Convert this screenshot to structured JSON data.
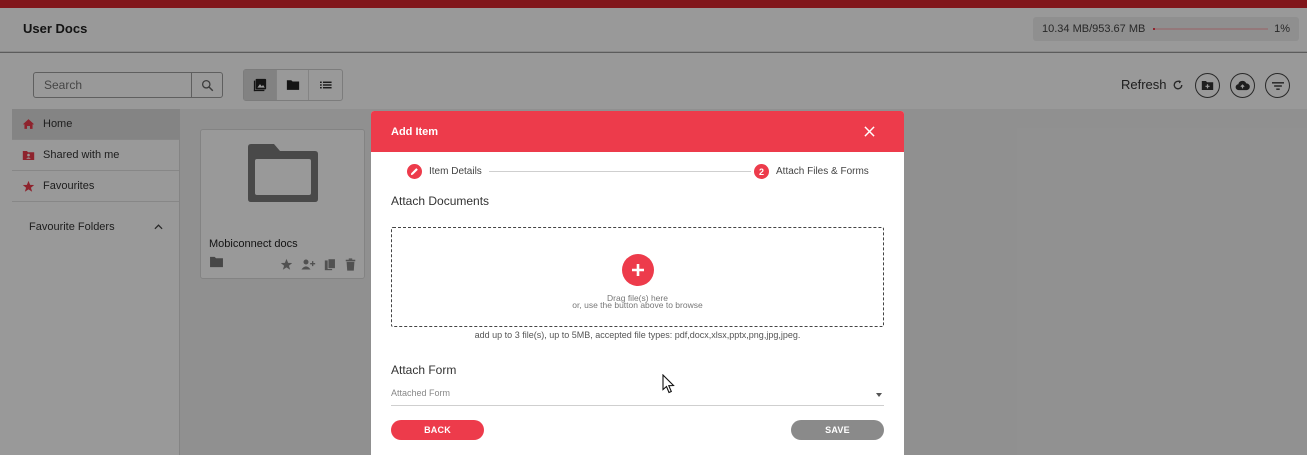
{
  "app": {
    "title": "User Docs",
    "accent_color": "#ed3b4b",
    "brand_bar_color": "#d8262e"
  },
  "storage": {
    "used_text": "10.34 MB/953.67 MB",
    "percent_text": "1%",
    "fill_fraction": 0.01
  },
  "toolbar": {
    "search_placeholder": "Search",
    "search_icon": "search-icon",
    "view_modes": [
      "gallery-view-icon",
      "folder-view-icon",
      "list-view-icon"
    ],
    "active_view": "gallery-view-icon",
    "refresh_label": "Refresh",
    "action_icons": [
      "new-folder-icon",
      "cloud-upload-icon",
      "filter-icon"
    ]
  },
  "sidebar": {
    "items": [
      {
        "label": "Home",
        "icon": "home-icon",
        "active": true
      },
      {
        "label": "Shared with me",
        "icon": "shared-folder-icon",
        "active": false
      },
      {
        "label": "Favourites",
        "icon": "star-icon",
        "active": false
      }
    ],
    "group_label": "Favourite Folders"
  },
  "documents": [
    {
      "name": "Mobiconnect docs",
      "actions": [
        "star-icon",
        "share-user-icon",
        "copy-icon",
        "delete-icon"
      ]
    }
  ],
  "modal": {
    "title": "Add Item",
    "steps": [
      {
        "label": "Item Details",
        "marker": "edit-icon"
      },
      {
        "label": "Attach Files & Forms",
        "marker": "2"
      }
    ],
    "attach_documents_label": "Attach Documents",
    "drop_line1": "Drag file(s) here",
    "drop_line2": "or, use the button above to browse",
    "hint": "add up to 3 file(s), up to 5MB, accepted file types: pdf,docx,xlsx,pptx,png,jpg,jpeg.",
    "attach_form_label": "Attach Form",
    "form_placeholder": "Attached Form",
    "back_label": "BACK",
    "save_label": "SAVE"
  }
}
